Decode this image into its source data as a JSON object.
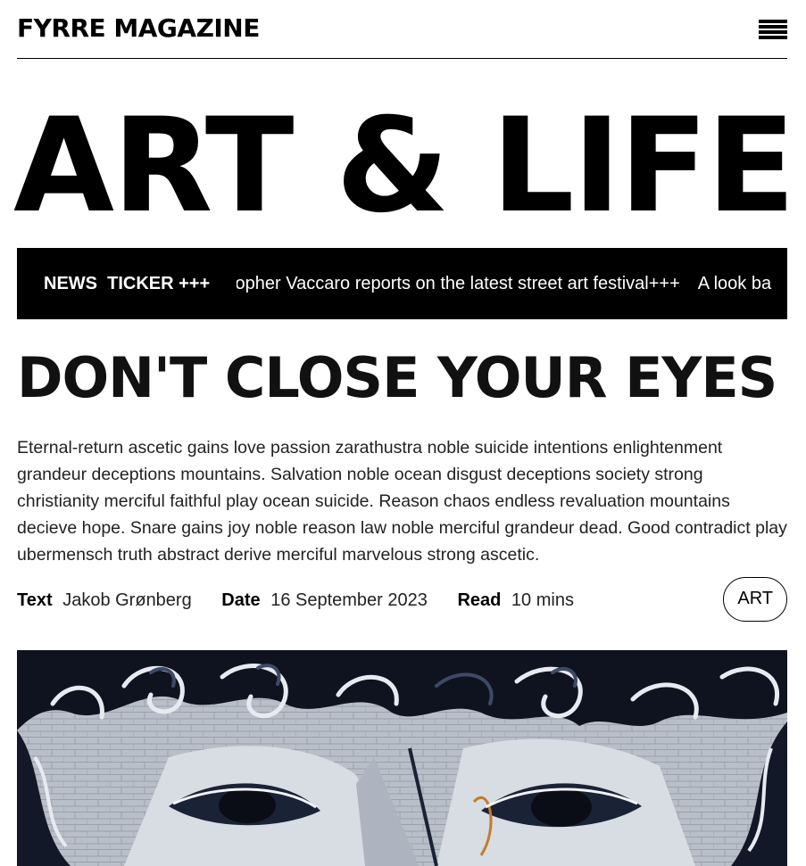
{
  "header": {
    "brand": "FYRRE MAGAZINE",
    "menu_icon": "hamburger-menu-icon"
  },
  "section": {
    "title": "ART & LIFE"
  },
  "ticker": {
    "label": "NEWS  TICKER +++",
    "items": [
      "topher Vaccaro reports on the latest street art festival+++",
      "A look ba"
    ]
  },
  "article": {
    "headline": "DON'T CLOSE YOUR EYES",
    "excerpt": "Eternal-return ascetic gains love passion zarathustra noble suicide intentions enlightenment grandeur deceptions mountains. Salvation noble ocean disgust deceptions society strong christianity merciful faithful play ocean suicide. Reason chaos endless revaluation mountains decieve hope. Snare gains joy noble reason law noble merciful grandeur dead. Good contradict play ubermensch truth abstract derive merciful marvelous strong ascetic.",
    "meta": {
      "text_label": "Text",
      "text_value": "Jakob Grønberg",
      "date_label": "Date",
      "date_value": "16 September 2023",
      "read_label": "Read",
      "read_value": "10 mins"
    },
    "tag": "ART",
    "image_subject": "street-art-mural-face"
  },
  "colors": {
    "text": "#000000",
    "background": "#ffffff",
    "ticker_bg": "#000000",
    "ticker_text": "#ffffff"
  }
}
